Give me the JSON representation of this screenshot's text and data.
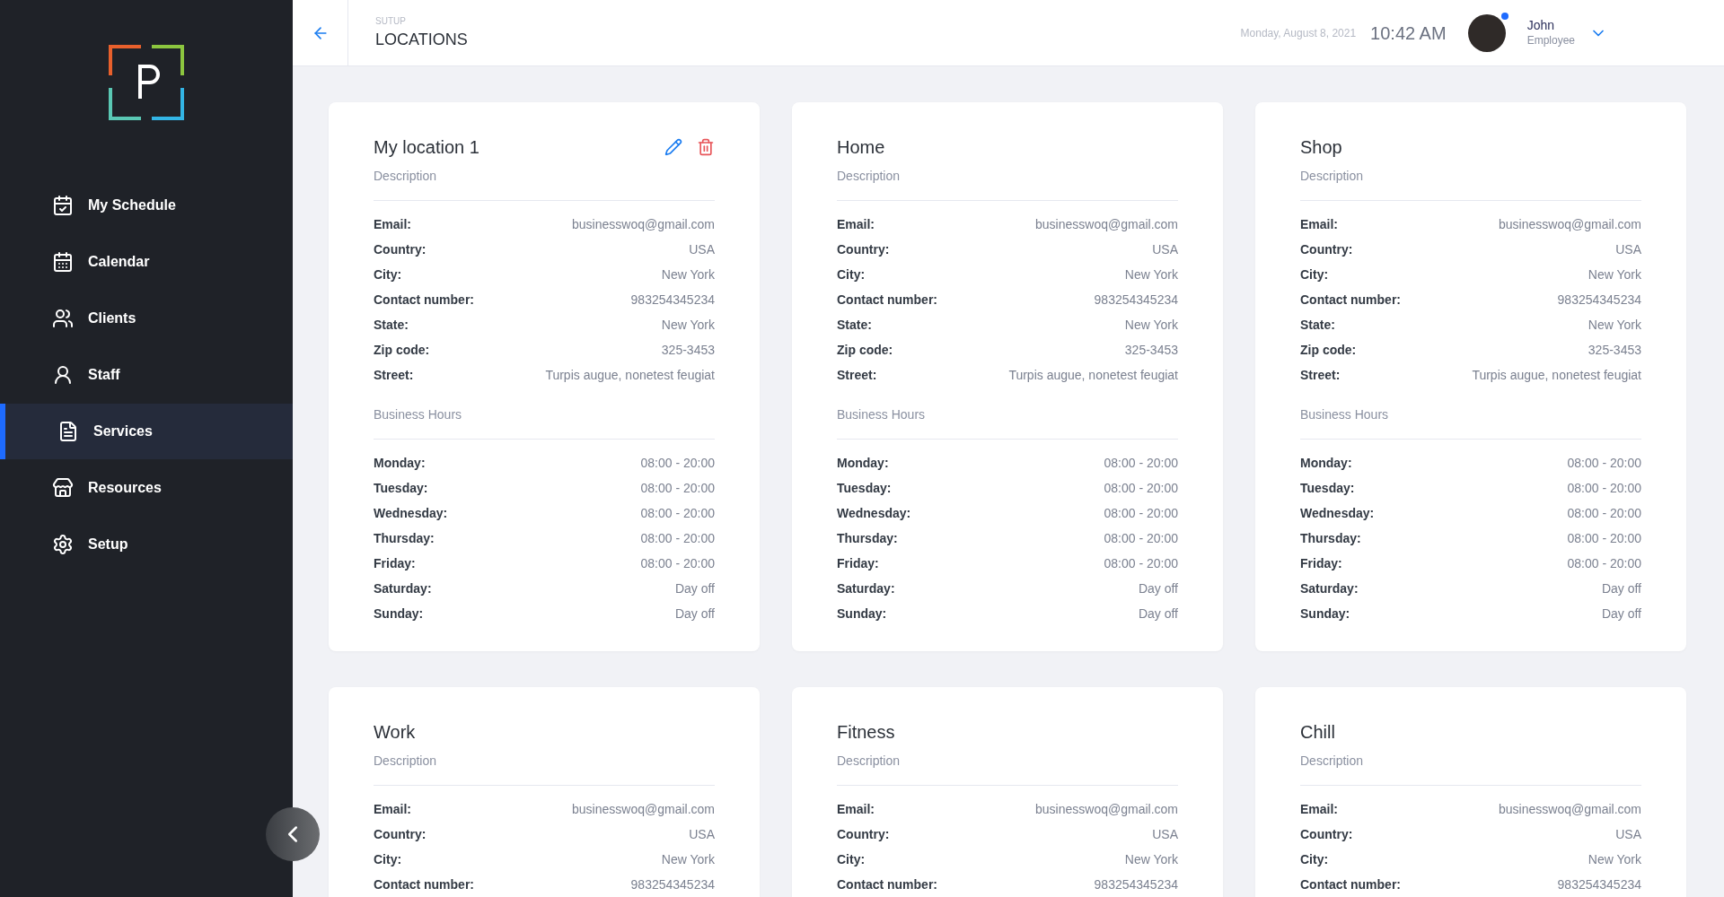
{
  "sidebar": {
    "items": [
      {
        "label": "My Schedule",
        "selected": false
      },
      {
        "label": "Calendar",
        "selected": false
      },
      {
        "label": "Clients",
        "selected": false
      },
      {
        "label": "Staff",
        "selected": false
      },
      {
        "label": "Services",
        "selected": true
      },
      {
        "label": "Resources",
        "selected": false
      },
      {
        "label": "Setup",
        "selected": false
      }
    ]
  },
  "header": {
    "breadcrumb": "SUTUP",
    "title": "LOCATIONS",
    "date": "Monday, August 8, 2021",
    "time": "10:42 AM",
    "user": {
      "name": "John",
      "role": "Employee",
      "online": true
    }
  },
  "cards": [
    {
      "title": "My location 1",
      "description": "Description",
      "editable": true,
      "details": [
        {
          "label": "Email:",
          "value": "businesswoq@gmail.com"
        },
        {
          "label": "Country:",
          "value": "USA"
        },
        {
          "label": "City:",
          "value": "New York"
        },
        {
          "label": "Contact number:",
          "value": "983254345234"
        },
        {
          "label": "State:",
          "value": "New York"
        },
        {
          "label": "Zip code:",
          "value": "325-3453"
        },
        {
          "label": "Street:",
          "value": "Turpis augue, nonetest feugiat"
        }
      ],
      "hours_title": "Business Hours",
      "hours": [
        {
          "day": "Monday:",
          "value": "08:00 - 20:00"
        },
        {
          "day": "Tuesday:",
          "value": "08:00 - 20:00"
        },
        {
          "day": "Wednesday:",
          "value": "08:00 - 20:00"
        },
        {
          "day": "Thursday:",
          "value": "08:00 - 20:00"
        },
        {
          "day": "Friday:",
          "value": "08:00 - 20:00"
        },
        {
          "day": "Saturday:",
          "value": "Day off"
        },
        {
          "day": "Sunday:",
          "value": "Day off"
        }
      ]
    },
    {
      "title": "Home",
      "description": "Description",
      "editable": false,
      "details": [
        {
          "label": "Email:",
          "value": "businesswoq@gmail.com"
        },
        {
          "label": "Country:",
          "value": "USA"
        },
        {
          "label": "City:",
          "value": "New York"
        },
        {
          "label": "Contact number:",
          "value": "983254345234"
        },
        {
          "label": "State:",
          "value": "New York"
        },
        {
          "label": "Zip code:",
          "value": "325-3453"
        },
        {
          "label": "Street:",
          "value": "Turpis augue, nonetest feugiat"
        }
      ],
      "hours_title": "Business Hours",
      "hours": [
        {
          "day": "Monday:",
          "value": "08:00 - 20:00"
        },
        {
          "day": "Tuesday:",
          "value": "08:00 - 20:00"
        },
        {
          "day": "Wednesday:",
          "value": "08:00 - 20:00"
        },
        {
          "day": "Thursday:",
          "value": "08:00 - 20:00"
        },
        {
          "day": "Friday:",
          "value": "08:00 - 20:00"
        },
        {
          "day": "Saturday:",
          "value": "Day off"
        },
        {
          "day": "Sunday:",
          "value": "Day off"
        }
      ]
    },
    {
      "title": "Shop",
      "description": "Description",
      "editable": false,
      "details": [
        {
          "label": "Email:",
          "value": "businesswoq@gmail.com"
        },
        {
          "label": "Country:",
          "value": "USA"
        },
        {
          "label": "City:",
          "value": "New York"
        },
        {
          "label": "Contact number:",
          "value": "983254345234"
        },
        {
          "label": "State:",
          "value": "New York"
        },
        {
          "label": "Zip code:",
          "value": "325-3453"
        },
        {
          "label": "Street:",
          "value": "Turpis augue, nonetest feugiat"
        }
      ],
      "hours_title": "Business Hours",
      "hours": [
        {
          "day": "Monday:",
          "value": "08:00 - 20:00"
        },
        {
          "day": "Tuesday:",
          "value": "08:00 - 20:00"
        },
        {
          "day": "Wednesday:",
          "value": "08:00 - 20:00"
        },
        {
          "day": "Thursday:",
          "value": "08:00 - 20:00"
        },
        {
          "day": "Friday:",
          "value": "08:00 - 20:00"
        },
        {
          "day": "Saturday:",
          "value": "Day off"
        },
        {
          "day": "Sunday:",
          "value": "Day off"
        }
      ]
    },
    {
      "title": "Work",
      "description": "Description",
      "editable": false,
      "details": [
        {
          "label": "Email:",
          "value": "businesswoq@gmail.com"
        },
        {
          "label": "Country:",
          "value": "USA"
        },
        {
          "label": "City:",
          "value": "New York"
        },
        {
          "label": "Contact number:",
          "value": "983254345234"
        }
      ]
    },
    {
      "title": "Fitness",
      "description": "Description",
      "editable": false,
      "details": [
        {
          "label": "Email:",
          "value": "businesswoq@gmail.com"
        },
        {
          "label": "Country:",
          "value": "USA"
        },
        {
          "label": "City:",
          "value": "New York"
        },
        {
          "label": "Contact number:",
          "value": "983254345234"
        }
      ]
    },
    {
      "title": "Chill",
      "description": "Description",
      "editable": false,
      "details": [
        {
          "label": "Email:",
          "value": "businesswoq@gmail.com"
        },
        {
          "label": "Country:",
          "value": "USA"
        },
        {
          "label": "City:",
          "value": "New York"
        },
        {
          "label": "Contact number:",
          "value": "983254345234"
        }
      ]
    }
  ]
}
